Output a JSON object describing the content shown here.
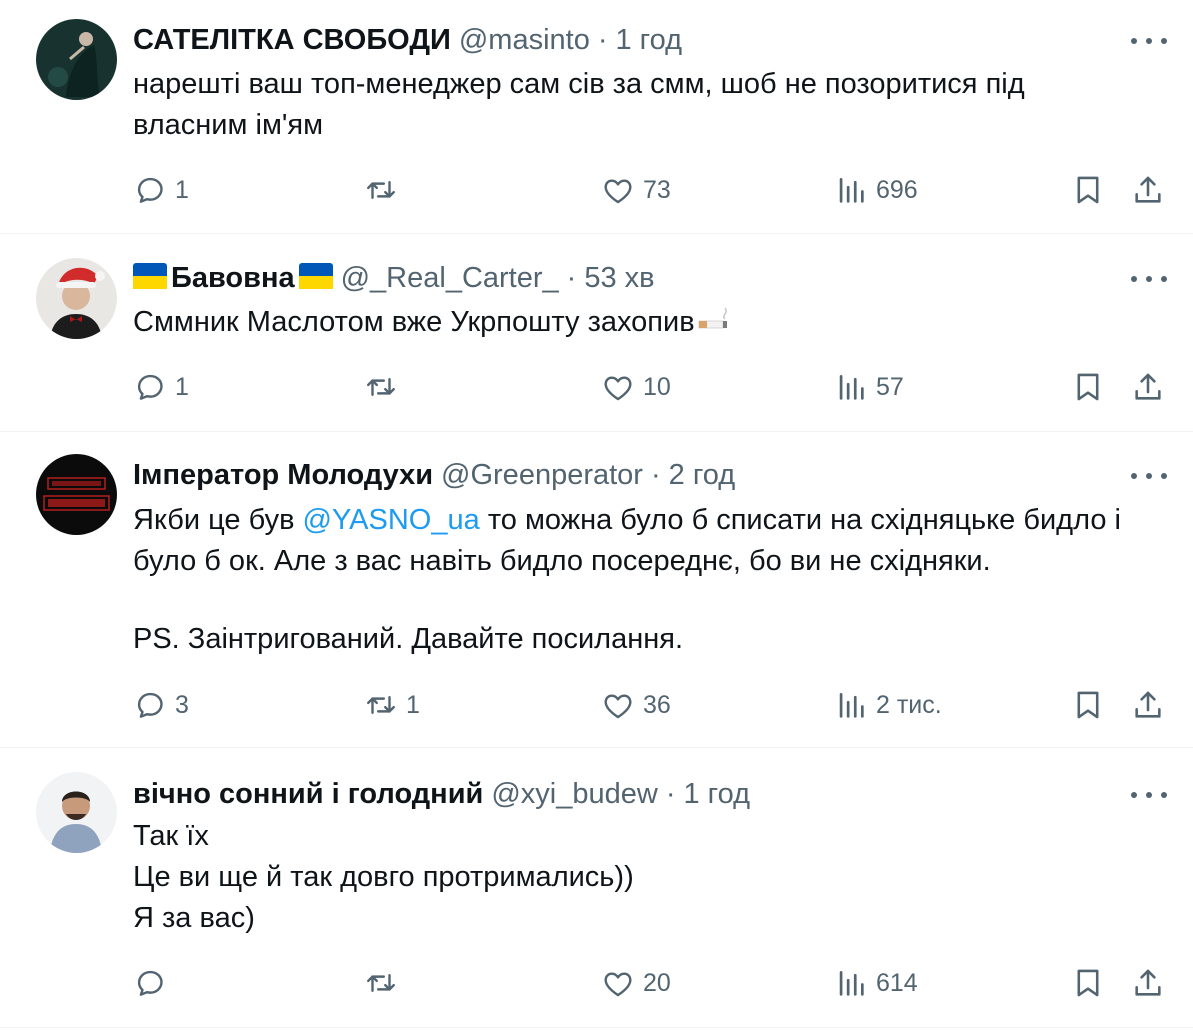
{
  "colors": {
    "text": "#0f1419",
    "secondary": "#536471",
    "link": "#1d9bf0",
    "divider": "#eff3f4"
  },
  "tweets": [
    {
      "name": "САТЕЛІТКА СВОБОДИ",
      "handle": "@masinto",
      "dot": "·",
      "time": "1 год",
      "lines": [
        "нарешті ваш топ-менеджер сам сів за смм, шоб не позоритися під",
        "власним ім'ям"
      ],
      "stats": {
        "replies": "1",
        "reposts": "",
        "likes": "73",
        "views": "696"
      }
    },
    {
      "name": "Бавовна",
      "name_flags": [
        "ukraine-flag-icon",
        "ukraine-flag-icon"
      ],
      "handle": "@_Real_Carter_",
      "dot": "·",
      "time": "53 хв",
      "lines": [
        "Сммник Маслотом вже Укрпошту захопив"
      ],
      "emoji": "cigarette-icon",
      "stats": {
        "replies": "1",
        "reposts": "",
        "likes": "10",
        "views": "57"
      }
    },
    {
      "name": "Імператор Молодухи",
      "handle": "@Greenperator",
      "dot": "·",
      "time": "2 год",
      "line1_before": "Якби це був",
      "mention": "@YASNO_ua",
      "line1_after": "то можна було б списати на східняцьке бидло і",
      "line2": "було б ок. Але з вас навіть бидло посереднє, бо ви не східняки.",
      "line3": "PS. Заінтригований. Давайте посилання.",
      "stats": {
        "replies": "3",
        "reposts": "1",
        "likes": "36",
        "views": "2 тис."
      }
    },
    {
      "name": "вічно сонний і голодний",
      "handle": "@xyi_budew",
      "dot": "·",
      "time": "1 год",
      "lines": [
        "Так їх",
        "Це ви ще й так довго протримались))",
        "Я за вас)"
      ],
      "stats": {
        "replies": "",
        "reposts": "",
        "likes": "20",
        "views": "614"
      }
    }
  ]
}
